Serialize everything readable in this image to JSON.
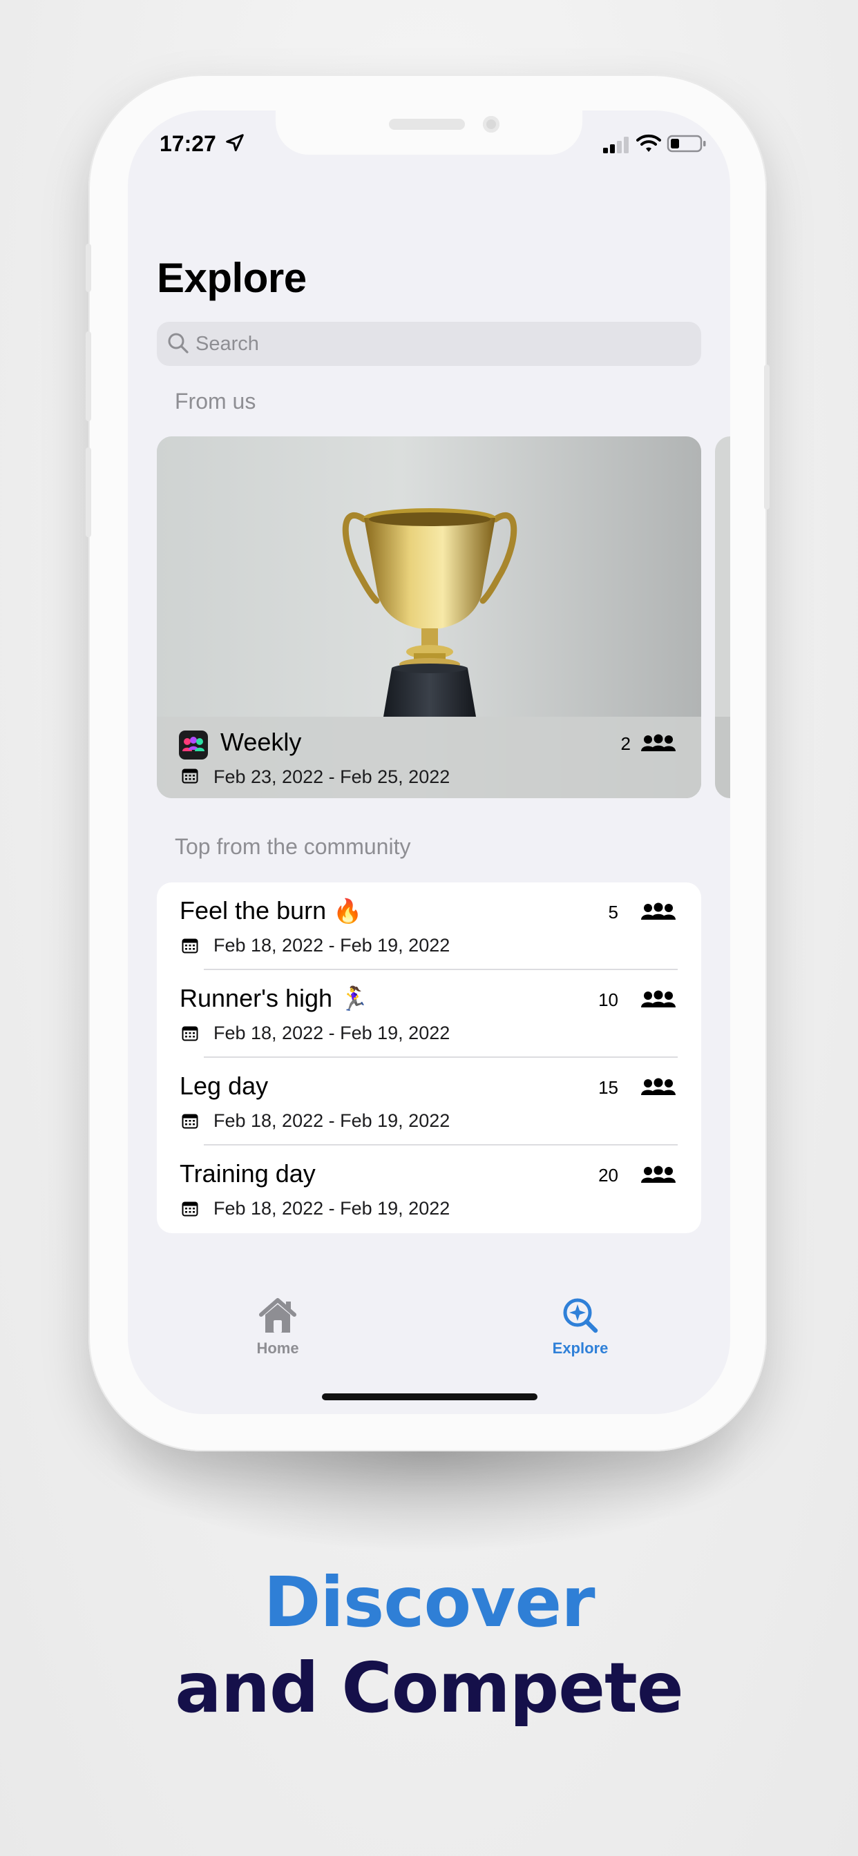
{
  "status_bar": {
    "time": "17:27"
  },
  "explore": {
    "title": "Explore",
    "search": {
      "placeholder": "Search"
    },
    "from_us": {
      "label": "From us",
      "card": {
        "title": "Weekly",
        "participants": "2",
        "dates": "Feb 23, 2022 - Feb 25, 2022",
        "image_subject": "trophy"
      }
    },
    "community": {
      "label": "Top from the community",
      "items": [
        {
          "title": "Feel the burn",
          "emoji": "🔥",
          "participants": "5",
          "dates": "Feb 18, 2022 - Feb 19, 2022"
        },
        {
          "title": "Runner's high",
          "emoji": "🏃‍♀️",
          "participants": "10",
          "dates": "Feb 18, 2022 - Feb 19, 2022"
        },
        {
          "title": "Leg day",
          "emoji": "",
          "participants": "15",
          "dates": "Feb 18, 2022 - Feb 19, 2022"
        },
        {
          "title": "Training day",
          "emoji": "",
          "participants": "20",
          "dates": "Feb 18, 2022 - Feb 19, 2022"
        }
      ]
    }
  },
  "tab_bar": {
    "items": [
      {
        "label": "Home",
        "icon": "house-icon",
        "selected": false
      },
      {
        "label": "Explore",
        "icon": "explore-search-icon",
        "selected": true
      }
    ]
  },
  "marketing": {
    "line1": "Discover",
    "line2": "and Compete"
  },
  "colors": {
    "accent": "#2f80d8",
    "headline_primary": "#2f7fd6",
    "headline_secondary": "#15104a",
    "tab_inactive": "#8e8e93",
    "screen_bg": "#f1f1f6"
  }
}
